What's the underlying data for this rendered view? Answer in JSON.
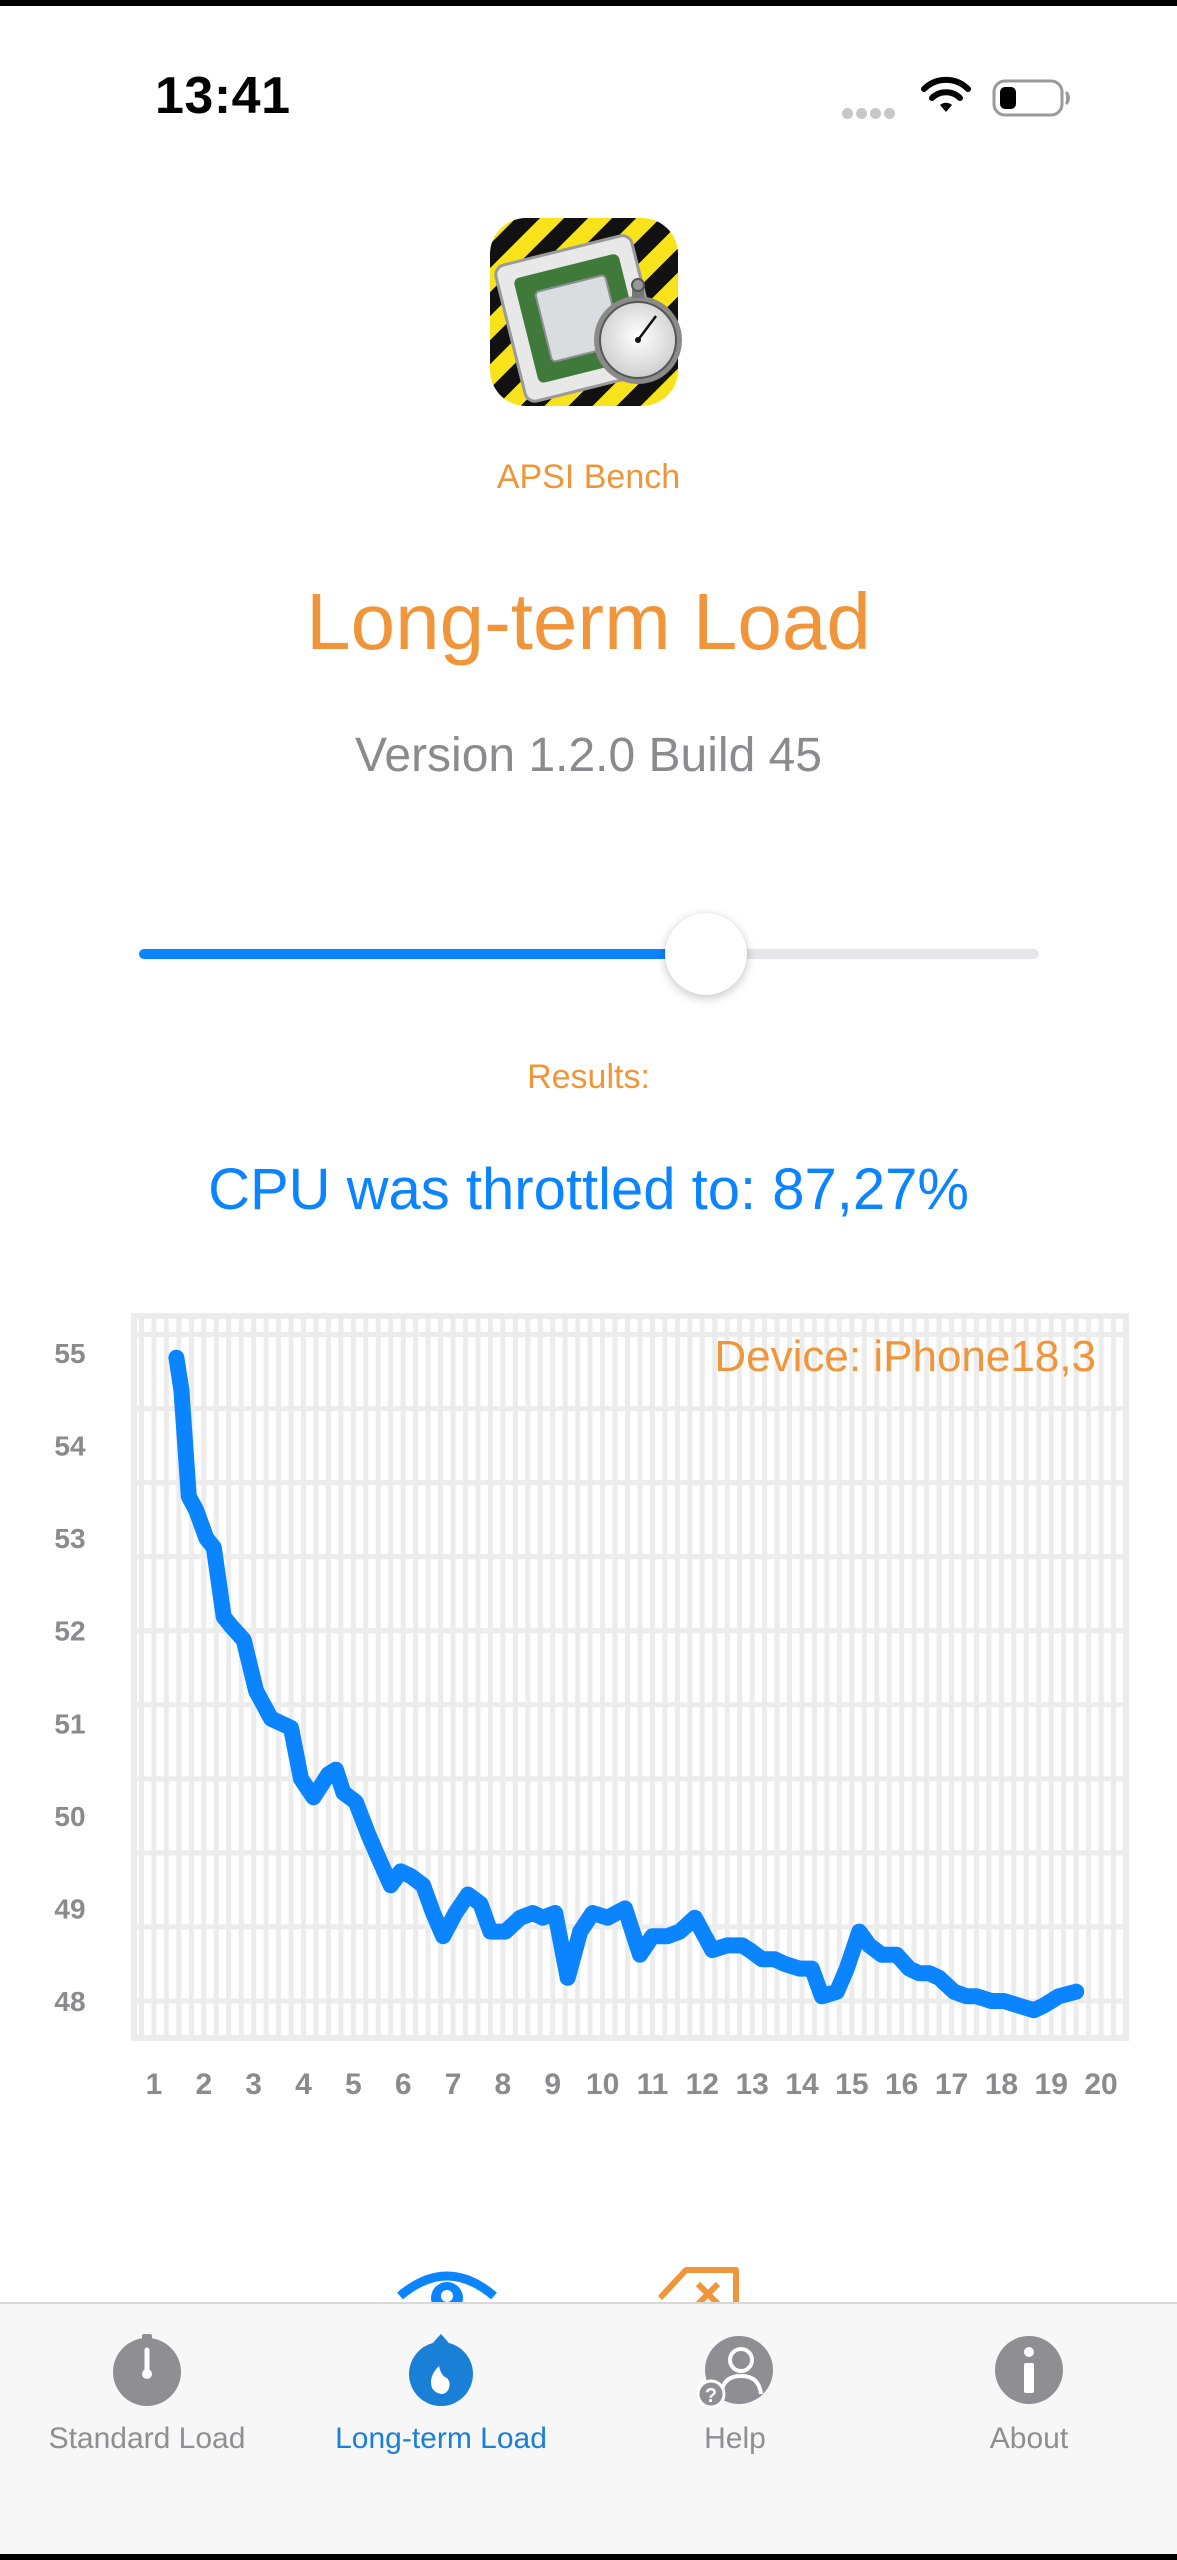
{
  "status_bar": {
    "time": "13:41"
  },
  "app": {
    "name": "APSI Bench",
    "icon": "stopwatch-on-cpu-app-icon"
  },
  "page": {
    "title": "Long-term Load",
    "version": "Version 1.2.0 Build 45"
  },
  "slider": {
    "value_fraction": 0.63
  },
  "results": {
    "label": "Results:",
    "throttle_text": "CPU was throttled to: 87,27%"
  },
  "chart_data": {
    "type": "line",
    "annotation": "Device: iPhone18,3",
    "x_ticks": [
      "1",
      "2",
      "3",
      "4",
      "5",
      "6",
      "7",
      "8",
      "9",
      "10",
      "11",
      "12",
      "13",
      "14",
      "15",
      "16",
      "17",
      "18",
      "19",
      "20"
    ],
    "y_ticks": [
      "55",
      "54",
      "53",
      "52",
      "51",
      "50",
      "49",
      "48"
    ],
    "xlim": [
      0.6,
      20.5
    ],
    "ylim": [
      47.6,
      55.4
    ],
    "grid": true,
    "colors": {
      "line": "#0a84ff",
      "grid": "#ececec",
      "annotation": "#f0953a"
    },
    "series": [
      {
        "x": [
          1.45,
          1.55,
          1.7,
          1.85,
          2.05,
          2.2,
          2.4,
          2.55,
          2.8,
          3.05,
          3.35,
          3.55,
          3.75,
          3.95,
          4.2,
          4.5,
          4.65,
          4.8,
          5.05,
          5.3,
          5.5,
          5.75,
          5.95,
          6.15,
          6.4,
          6.6,
          6.8,
          7.05,
          7.3,
          7.55,
          7.75,
          8.05,
          8.35,
          8.6,
          8.8,
          9.05,
          9.3,
          9.55,
          9.8,
          10.1,
          10.45,
          10.75,
          11.0,
          11.3,
          11.55,
          11.85,
          12.2,
          12.5,
          12.8,
          12.95,
          13.2,
          13.45,
          13.65,
          13.95,
          14.2,
          14.4,
          14.7,
          14.9,
          15.15,
          15.35,
          15.6,
          15.9,
          16.15,
          16.35,
          16.55,
          16.75,
          17.05,
          17.3,
          17.5,
          17.8,
          18.05,
          18.35,
          18.65,
          18.85,
          19.0,
          19.15,
          19.5
        ],
        "y": [
          54.95,
          54.6,
          53.45,
          53.3,
          53.0,
          52.9,
          52.15,
          52.05,
          51.9,
          51.35,
          51.05,
          51.0,
          50.95,
          50.4,
          50.2,
          50.45,
          50.5,
          50.25,
          50.15,
          49.8,
          49.55,
          49.25,
          49.4,
          49.35,
          49.25,
          48.95,
          48.7,
          48.95,
          49.15,
          49.05,
          48.75,
          48.75,
          48.9,
          48.95,
          48.9,
          48.95,
          48.25,
          48.75,
          48.95,
          48.9,
          49.0,
          48.5,
          48.7,
          48.7,
          48.75,
          48.9,
          48.55,
          48.6,
          48.6,
          48.55,
          48.45,
          48.45,
          48.4,
          48.35,
          48.35,
          48.05,
          48.1,
          48.35,
          48.75,
          48.6,
          48.5,
          48.5,
          48.35,
          48.3,
          48.3,
          48.25,
          48.1,
          48.05,
          48.05,
          48.0,
          48.0,
          47.95,
          47.9,
          47.95,
          48.0,
          48.05,
          48.1
        ]
      }
    ]
  },
  "tabs": [
    {
      "label": "Standard Load",
      "icon": "stopwatch-icon",
      "active": false
    },
    {
      "label": "Long-term Load",
      "icon": "flame-icon",
      "active": true
    },
    {
      "label": "Help",
      "icon": "person-help-icon",
      "active": false
    },
    {
      "label": "About",
      "icon": "info-icon",
      "active": false
    }
  ]
}
